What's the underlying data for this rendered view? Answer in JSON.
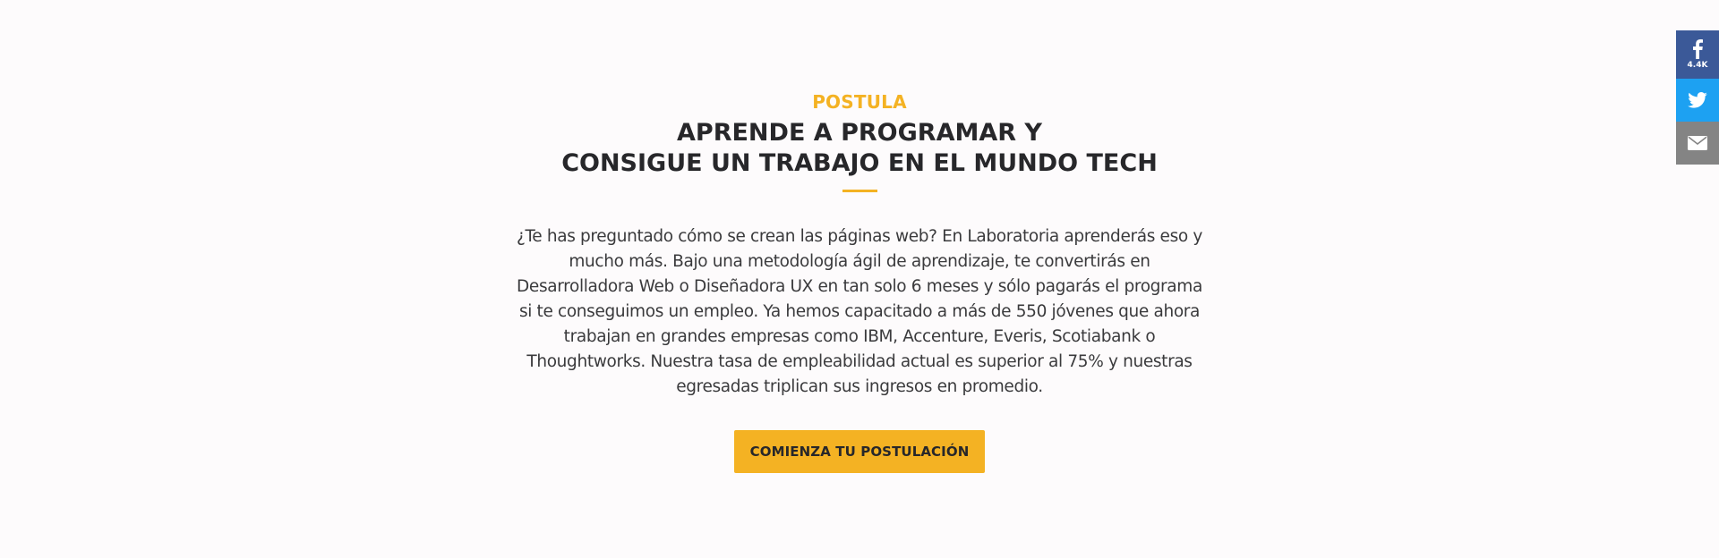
{
  "section": {
    "eyebrow": "POSTULA",
    "title_line1": "APRENDE A PROGRAMAR Y",
    "title_line2": "CONSIGUE UN TRABAJO EN EL MUNDO TECH",
    "body": "¿Te has preguntado cómo se crean las páginas web? En Laboratoria aprenderás eso y mucho más. Bajo una metodología ágil de aprendizaje, te convertirás en Desarrolladora Web o Diseñadora UX en tan solo 6 meses y sólo pagarás el programa si te conseguimos un empleo. Ya hemos capacitado a más de 550 jóvenes que ahora trabajan en grandes empresas como IBM, Accenture, Everis, Scotiabank o Thoughtworks. Nuestra tasa de empleabilidad actual es superior al 75% y nuestras egresadas triplican sus ingresos en promedio.",
    "cta_label": "COMIENZA TU POSTULACIÓN"
  },
  "share": {
    "facebook": {
      "icon": "facebook-icon",
      "count": "4.4K",
      "color": "#3b5998"
    },
    "twitter": {
      "icon": "twitter-icon",
      "color": "#1da1f2"
    },
    "email": {
      "icon": "email-icon",
      "color": "#848484"
    }
  },
  "colors": {
    "accent": "#f4b223",
    "heading": "#27272a",
    "text": "#3a3a3c",
    "background": "#fdfbfc"
  }
}
